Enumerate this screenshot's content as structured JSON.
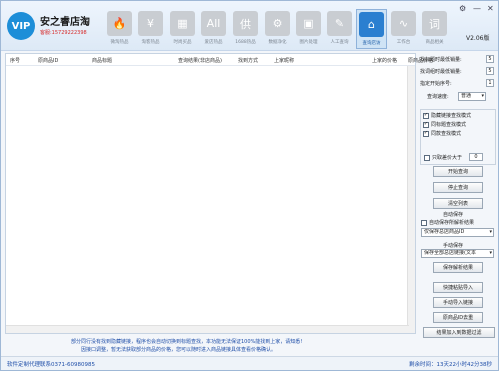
{
  "app": {
    "logo": "VIP",
    "name": "安之睿店淘",
    "hotline": "客服:15729222398",
    "version": "V2.06版"
  },
  "nav": [
    {
      "label": "微淘热品",
      "glyph": "🔥",
      "icon": "flame-icon"
    },
    {
      "label": "淘客热品",
      "glyph": "¥",
      "icon": "yen-icon"
    },
    {
      "label": "时尚买品",
      "glyph": "▦",
      "icon": "shop-grid-icon"
    },
    {
      "label": "爱店热品",
      "glyph": "All",
      "icon": "all-icon"
    },
    {
      "label": "1688热品",
      "glyph": "供",
      "icon": "supply-icon"
    },
    {
      "label": "数据净化",
      "glyph": "⚙",
      "icon": "gear-cleanup-icon"
    },
    {
      "label": "图片处理",
      "glyph": "▣",
      "icon": "image-icon"
    },
    {
      "label": "人工查询",
      "glyph": "✎",
      "icon": "broom-icon"
    },
    {
      "label": "查询店访",
      "glyph": "⌂",
      "icon": "store-home-icon",
      "active": true
    },
    {
      "label": "工作台",
      "glyph": "∿",
      "icon": "chart-line-icon"
    },
    {
      "label": "商品相关",
      "glyph": "词",
      "icon": "word-icon"
    }
  ],
  "window_controls": {
    "settings": "⚙",
    "minimize": "—",
    "close": "✕"
  },
  "table": {
    "columns": [
      "序号",
      "原商品ID",
      "商品标题",
      "查询结果(非店商品)",
      "找到方式",
      "上家昵称",
      "上家的价格",
      "原商品价格"
    ]
  },
  "panel": {
    "max_page_label": "找标题时最低销量:",
    "max_page_value": "5",
    "min_sales_label": "找词组时最低销量:",
    "min_sales_value": "5",
    "start_label": "指定开始序号:",
    "start_value": "1",
    "speed_label": "查询速度:",
    "speed_value": "普通",
    "checkboxes": [
      {
        "label": "隐藏链接查找模式",
        "checked": true
      },
      {
        "label": "同标题查找模式",
        "checked": true
      },
      {
        "label": "同款查找模式",
        "checked": true
      }
    ],
    "price_filter_label": "只取差价大于",
    "price_filter_value": "0",
    "price_filter_checked": false,
    "buttons": {
      "start": "开始查询",
      "stop": "停止查询",
      "clear": "清空列表"
    },
    "autosave_title": "自动保存",
    "autosave_check_label": "自动保存所解析结果",
    "autosave_checked": false,
    "autosave_select": "仅保存总店商品ID",
    "manual_title": "手动保存",
    "manual_select": "保存全部总店链接(文本",
    "save_btn": "保存解析结果",
    "quick_import": "快捷粘贴导入",
    "manual_import": "手动导入链接",
    "dedupe": "原商品ID去重",
    "export": "结果加入到数据过滤"
  },
  "notice": {
    "line1": "部分同行没有找到隐藏链接，程序也会自动切换到标题查找，本功能无法保证100%能找到上家，请知悉!",
    "line2": "因接口调整，暂无法获取部分商品的价格，您可以随时进入商品链接具体查看价格确认。"
  },
  "status": {
    "left": "软件定制代理联系0371-60980985",
    "right": "剩余时间：13天22小时42分38秒"
  }
}
